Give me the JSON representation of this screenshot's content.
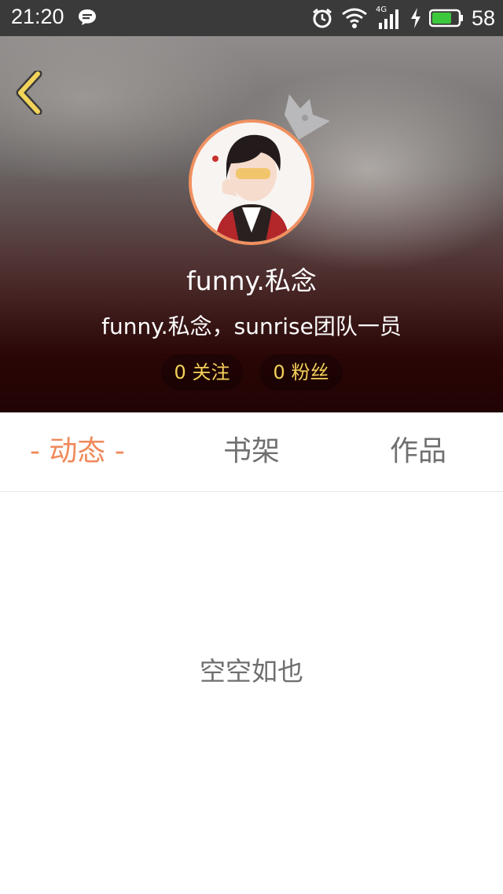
{
  "status_bar": {
    "time": "21:20",
    "network": "4G",
    "battery": "58",
    "icons": [
      "message-icon",
      "alarm-icon",
      "wifi-icon",
      "signal-icon",
      "charging-icon",
      "battery-icon"
    ]
  },
  "profile": {
    "username": "funny.私念",
    "bio": "funny.私念，sunrise团队一员",
    "follow_label": "0 关注",
    "fans_label": "0 粉丝"
  },
  "tabs": [
    {
      "label": "- 动态 -",
      "active": true
    },
    {
      "label": "书架",
      "active": false
    },
    {
      "label": "作品",
      "active": false
    }
  ],
  "empty_state": {
    "text": "空空如也"
  },
  "colors": {
    "accent": "#f0895a",
    "pill_text": "#f5d15a",
    "back_arrow": "#f2d45b"
  }
}
